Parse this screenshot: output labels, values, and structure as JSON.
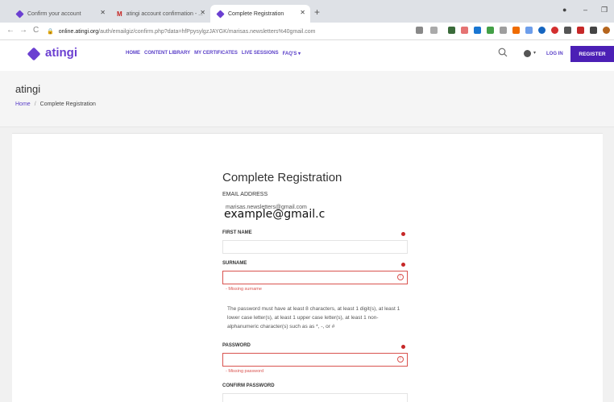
{
  "browser": {
    "tabs": [
      {
        "title": "Confirm your account"
      },
      {
        "title": "atingi account confirmation - ..."
      },
      {
        "title": "Complete Registration"
      }
    ],
    "url_domain": "online.atingi.org",
    "url_path": "/auth/emailgiz/confirm.php?data=hfPpysylgzJAYGK/marisas.newsletters%40gmail.com"
  },
  "header": {
    "logo": "atingi",
    "nav": [
      "HOME",
      "CONTENT LIBRARY",
      "MY CERTIFICATES",
      "LIVE SESSIONS",
      "FAQ'S ▾"
    ],
    "login": "LOG IN",
    "register": "REGISTER"
  },
  "hero": {
    "title": "atingi",
    "breadcrumb_home": "Home",
    "breadcrumb_sep": "/",
    "breadcrumb_current": "Complete Registration"
  },
  "form": {
    "title": "Complete Registration",
    "email_label": "EMAIL ADDRESS",
    "email_value": "marisas.newsletters@gmail.com",
    "overlay": "example@gmail.c",
    "first_name_label": "FIRST NAME",
    "surname_label": "SURNAME",
    "surname_error": "- Missing surname",
    "password_hint": "The password must have at least 8 characters, at least 1 digit(s), at least 1 lower case letter(s), at least 1 upper case letter(s), at least 1 non-alphanumeric character(s) such as as *, -, or #",
    "password_label": "PASSWORD",
    "password_error": "- Missing password",
    "confirm_label": "CONFIRM PASSWORD"
  },
  "colors": {
    "brand": "#6b3fd1",
    "register_bg": "#4b1fb5",
    "error": "#d9534f"
  }
}
